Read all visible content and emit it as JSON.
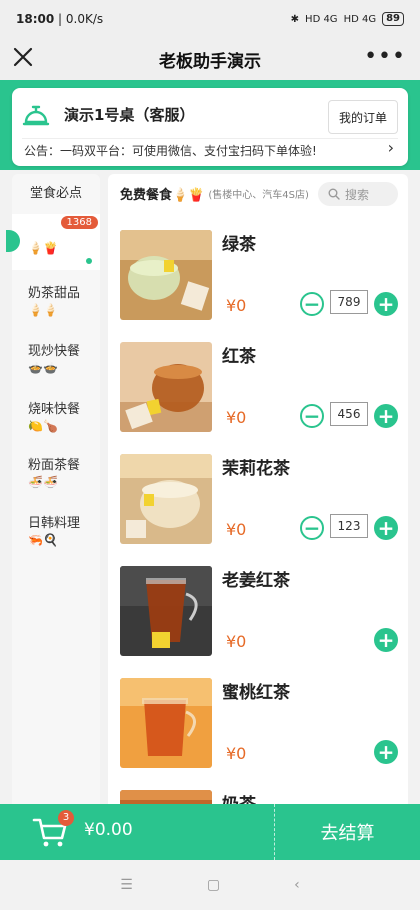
{
  "status_bar": {
    "time": "18:00",
    "speed": "0.0K/s",
    "network1": "HD 4G",
    "network2": "HD 4G",
    "battery": "89"
  },
  "nav": {
    "title": "老板助手演示"
  },
  "table": {
    "name": "演示1号桌（客服）",
    "my_orders": "我的订单",
    "notice": "公告：一码双平台：可使用微信、支付宝扫码下单体验!"
  },
  "sidebar": {
    "title": "堂食必点",
    "badge": "1368",
    "items": [
      {
        "label": "免费餐食",
        "emojis": "🍦🍟"
      },
      {
        "label": "奶茶甜品",
        "emojis": "🍦🍦"
      },
      {
        "label": "现炒快餐",
        "emojis": "🍲🍲"
      },
      {
        "label": "烧味快餐",
        "emojis": "🍋🍗"
      },
      {
        "label": "粉面茶餐",
        "emojis": "🍜🍜"
      },
      {
        "label": "日韩料理",
        "emojis": "🦐🍳"
      }
    ]
  },
  "section": {
    "title": "免费餐食🍦🍟",
    "subtitle": "(售楼中心、汽车4S店)",
    "search_placeholder": "搜索"
  },
  "products": [
    {
      "name": "绿茶",
      "price": "¥0",
      "qty": "789"
    },
    {
      "name": "红茶",
      "price": "¥0",
      "qty": "456"
    },
    {
      "name": "茉莉花茶",
      "price": "¥0",
      "qty": "123"
    },
    {
      "name": "老姜红茶",
      "price": "¥0"
    },
    {
      "name": "蜜桃红茶",
      "price": "¥0"
    },
    {
      "name": "奶茶"
    }
  ],
  "cart": {
    "count": "3",
    "total": "¥0.00",
    "checkout": "去结算"
  },
  "colors": {
    "accent": "#2ac48e",
    "price": "#e66a27",
    "badge": "#e45b3a"
  }
}
